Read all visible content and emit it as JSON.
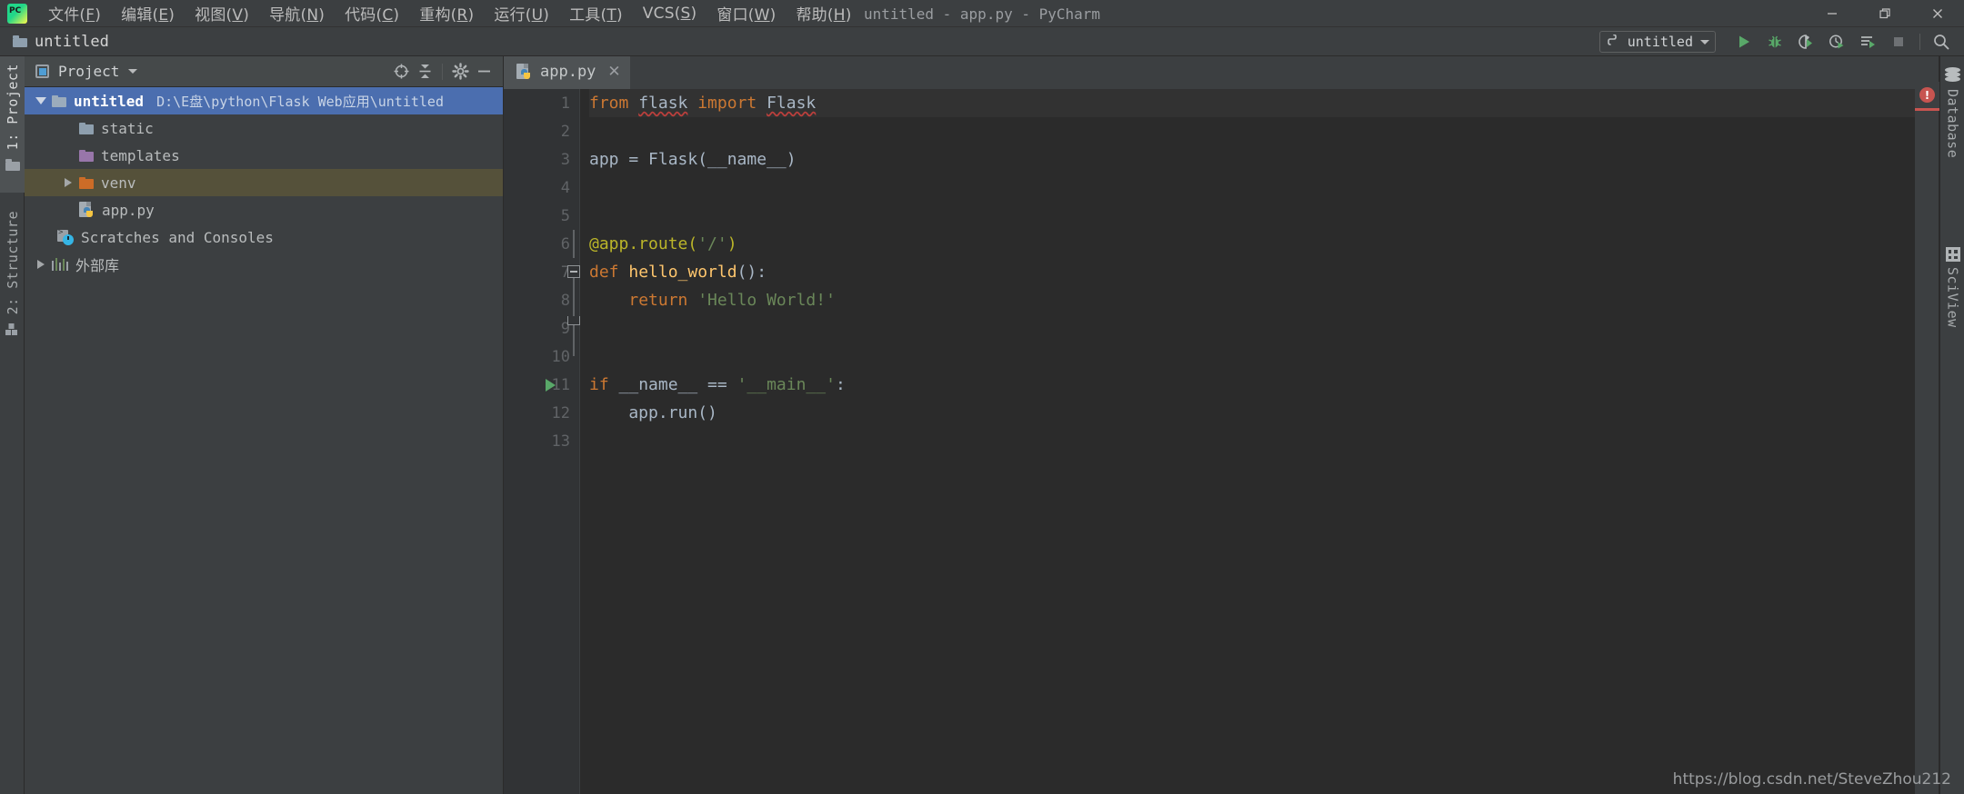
{
  "window": {
    "title": "untitled - app.py - PyCharm",
    "minimize_label": "—",
    "maximize_label": "❐",
    "close_label": "✕"
  },
  "menu": {
    "items": [
      {
        "label": "文件",
        "mnemonic": "F"
      },
      {
        "label": "编辑",
        "mnemonic": "E"
      },
      {
        "label": "视图",
        "mnemonic": "V"
      },
      {
        "label": "导航",
        "mnemonic": "N"
      },
      {
        "label": "代码",
        "mnemonic": "C"
      },
      {
        "label": "重构",
        "mnemonic": "R"
      },
      {
        "label": "运行",
        "mnemonic": "U"
      },
      {
        "label": "工具",
        "mnemonic": "T"
      },
      {
        "label": "VCS",
        "mnemonic": "S"
      },
      {
        "label": "窗口",
        "mnemonic": "W"
      },
      {
        "label": "帮助",
        "mnemonic": "H"
      }
    ]
  },
  "navbar": {
    "breadcrumb": "untitled",
    "run_config": {
      "name": "untitled",
      "icon": "python-icon"
    },
    "toolbar_buttons": [
      {
        "name": "run-button",
        "icon": "play-icon",
        "color": "#59a869"
      },
      {
        "name": "debug-button",
        "icon": "bug-icon",
        "color": "#59a869"
      },
      {
        "name": "run-coverage-button",
        "icon": "coverage-icon",
        "color": "#59a869"
      },
      {
        "name": "profile-button",
        "icon": "profiler-icon",
        "color": "#59a869"
      },
      {
        "name": "run-with-console-button",
        "icon": "run-list-icon",
        "color": "#59a869"
      },
      {
        "name": "stop-button",
        "icon": "stop-icon",
        "color": "#6e7174"
      },
      {
        "name": "search-everywhere-button",
        "icon": "search-icon",
        "color": "#b3b6b8"
      }
    ]
  },
  "left_strip": {
    "tabs": [
      {
        "label": "1: Project",
        "icon": "folder-icon",
        "active": true
      },
      {
        "label": "2: Structure",
        "icon": "structure-icon",
        "active": false
      }
    ]
  },
  "project_panel": {
    "header": {
      "title": "Project",
      "actions": [
        {
          "name": "select-opened-file-button",
          "icon": "target-icon"
        },
        {
          "name": "collapse-all-button",
          "icon": "collapse-icon"
        },
        {
          "name": "settings-button",
          "icon": "gear-icon"
        },
        {
          "name": "hide-button",
          "icon": "minus-icon"
        }
      ]
    },
    "tree": [
      {
        "label": "untitled",
        "sublabel": "D:\\E盘\\python\\Flask Web应用\\untitled",
        "icon": "folder-icon",
        "icon_color": "#8e9fae",
        "indent": 0,
        "twisty": "down",
        "state": "selected",
        "bold": true
      },
      {
        "label": "static",
        "sublabel": "",
        "icon": "folder-icon",
        "icon_color": "#8e9fae",
        "indent": 1,
        "twisty": "none",
        "state": "none",
        "bold": false
      },
      {
        "label": "templates",
        "sublabel": "",
        "icon": "folder-icon",
        "icon_color": "#9876aa",
        "indent": 1,
        "twisty": "none",
        "state": "none",
        "bold": false
      },
      {
        "label": "venv",
        "sublabel": "",
        "icon": "folder-icon",
        "icon_color": "#cc6c27",
        "indent": 1,
        "twisty": "right",
        "state": "highlighted",
        "bold": false
      },
      {
        "label": "app.py",
        "sublabel": "",
        "icon": "python-file-icon",
        "icon_color": "#4584b6",
        "indent": 1,
        "twisty": "none",
        "state": "none",
        "bold": false
      },
      {
        "label": "Scratches and Consoles",
        "sublabel": "",
        "icon": "scratches-icon",
        "icon_color": "#35b5e5",
        "indent": 0,
        "twisty": "none",
        "state": "none",
        "bold": false
      },
      {
        "label": "外部库",
        "sublabel": "",
        "icon": "external-libraries-icon",
        "icon_color": "#6a8759",
        "indent": 0,
        "twisty": "right",
        "state": "none",
        "bold": false
      }
    ]
  },
  "editor": {
    "tabs": [
      {
        "label": "app.py",
        "icon": "python-file-icon",
        "close": "✕",
        "active": true
      }
    ],
    "line_numbers": [
      "1",
      "2",
      "3",
      "4",
      "5",
      "6",
      "7",
      "8",
      "9",
      "10",
      "11",
      "12",
      "13"
    ],
    "run_gutter_line": 11,
    "lines": [
      {
        "n": 1,
        "tokens": [
          {
            "t": "from ",
            "c": "kw"
          },
          {
            "t": "flask",
            "c": "mod err"
          },
          {
            "t": " ",
            "c": "pun"
          },
          {
            "t": "import ",
            "c": "kw"
          },
          {
            "t": "Flask",
            "c": "cls err"
          }
        ]
      },
      {
        "n": 2,
        "tokens": []
      },
      {
        "n": 3,
        "tokens": [
          {
            "t": "app = Flask(__name__)",
            "c": "pun"
          }
        ]
      },
      {
        "n": 4,
        "tokens": []
      },
      {
        "n": 5,
        "tokens": []
      },
      {
        "n": 6,
        "tokens": [
          {
            "t": "@app.route(",
            "c": "dec"
          },
          {
            "t": "'/'",
            "c": "str"
          },
          {
            "t": ")",
            "c": "dec"
          }
        ]
      },
      {
        "n": 7,
        "tokens": [
          {
            "t": "def ",
            "c": "kw"
          },
          {
            "t": "hello_world",
            "c": "fn"
          },
          {
            "t": "():",
            "c": "pun"
          }
        ]
      },
      {
        "n": 8,
        "tokens": [
          {
            "t": "    ",
            "c": "pun"
          },
          {
            "t": "return ",
            "c": "kw"
          },
          {
            "t": "'Hello World!'",
            "c": "str"
          }
        ]
      },
      {
        "n": 9,
        "tokens": []
      },
      {
        "n": 10,
        "tokens": []
      },
      {
        "n": 11,
        "tokens": [
          {
            "t": "if ",
            "c": "kw"
          },
          {
            "t": "__name__ == ",
            "c": "pun"
          },
          {
            "t": "'__main__'",
            "c": "str"
          },
          {
            "t": ":",
            "c": "pun"
          }
        ]
      },
      {
        "n": 12,
        "tokens": [
          {
            "t": "    app.run()",
            "c": "pun"
          }
        ]
      },
      {
        "n": 13,
        "tokens": []
      }
    ]
  },
  "right_strip": {
    "error_badge": {
      "label": "!",
      "color": "#c75450"
    },
    "tabs": [
      {
        "label": "Database",
        "icon": "database-icon"
      },
      {
        "label": "SciView",
        "icon": "grid-icon"
      }
    ]
  },
  "watermark": {
    "text": "https://blog.csdn.net/SteveZhou212"
  },
  "colors": {
    "chrome": "#3c3f41",
    "editor_bg": "#2b2b2b",
    "gutter_bg": "#313335",
    "selection": "#4b6eaf",
    "accent_green": "#59a869",
    "error_red": "#c75450"
  }
}
